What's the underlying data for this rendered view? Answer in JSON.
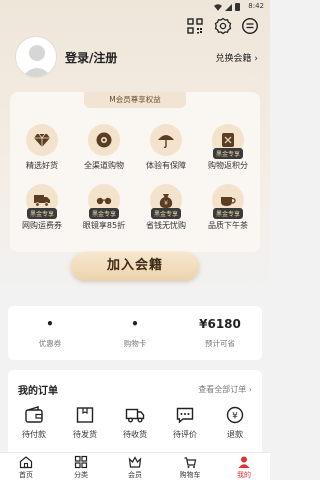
{
  "status": {
    "time": "8:42"
  },
  "profile": {
    "login_label": "登录/注册",
    "redeem_label": "兑换会籍 ›"
  },
  "benefits": {
    "title": "M会员尊享权益",
    "items": [
      {
        "label": "精选好货",
        "icon": "diamond-icon",
        "tag": ""
      },
      {
        "label": "全渠道购物",
        "icon": "globe-icon",
        "tag": ""
      },
      {
        "label": "体验有保障",
        "icon": "umbrella-icon",
        "tag": ""
      },
      {
        "label": "购物返积分",
        "icon": "points-icon",
        "tag": "黑金专享"
      },
      {
        "label": "网购运费券",
        "icon": "truck-icon",
        "tag": "黑金专享"
      },
      {
        "label": "眼镜享85折",
        "icon": "glasses-icon",
        "tag": "黑金专享"
      },
      {
        "label": "省钱无忧购",
        "icon": "money-bag-icon",
        "tag": "黑金专享"
      },
      {
        "label": "品质下午茶",
        "icon": "tea-icon",
        "tag": "黑金专享"
      }
    ]
  },
  "join_label": "加入会籍",
  "stats": [
    {
      "value": "•",
      "label": "优惠券"
    },
    {
      "value": "•",
      "label": "购物卡"
    },
    {
      "value": "¥6180",
      "label": "预计可省"
    }
  ],
  "orders": {
    "title": "我的订单",
    "view_all": "查看全部订单 ›",
    "items": [
      {
        "label": "待付款",
        "icon": "wallet-icon"
      },
      {
        "label": "待发货",
        "icon": "box-icon"
      },
      {
        "label": "待收货",
        "icon": "truck-icon"
      },
      {
        "label": "待评价",
        "icon": "comment-icon"
      },
      {
        "label": "退款",
        "icon": "refund-icon"
      }
    ]
  },
  "tabs": [
    {
      "label": "首页",
      "icon": "home-icon"
    },
    {
      "label": "分类",
      "icon": "grid-icon"
    },
    {
      "label": "会员",
      "icon": "crown-icon"
    },
    {
      "label": "购物车",
      "icon": "cart-icon"
    },
    {
      "label": "我的",
      "icon": "user-icon"
    }
  ],
  "colors": {
    "accent": "#e4312f",
    "gold": "#c89b5e",
    "dark": "#3a3a3a"
  }
}
